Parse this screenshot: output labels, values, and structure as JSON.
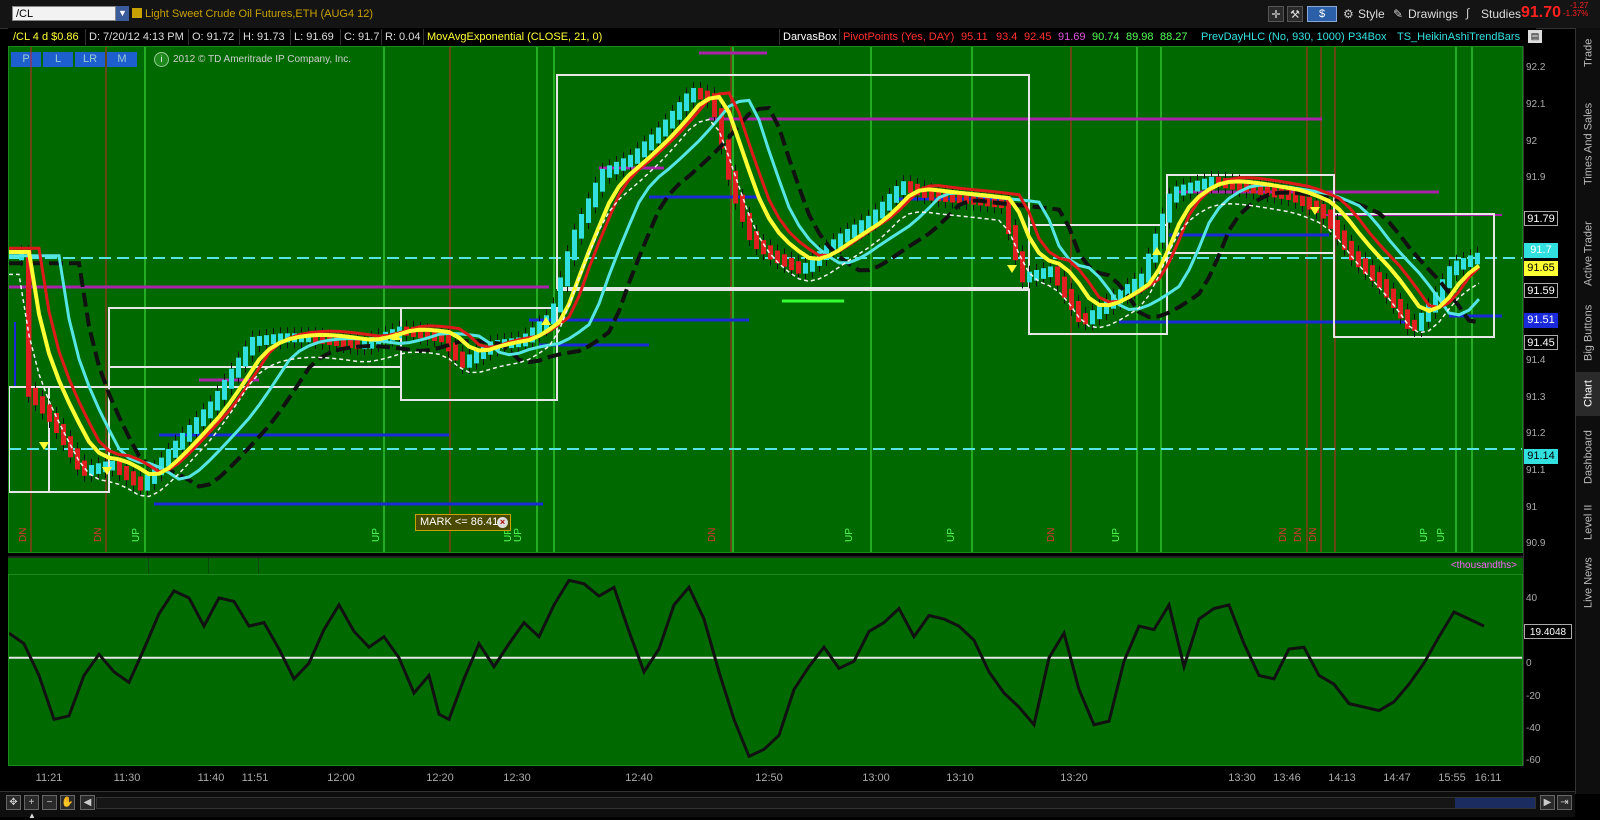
{
  "toolbar": {
    "symbol": "/CL",
    "instrument": "Light Sweet Crude Oil Futures,ETH (AUG4 12)",
    "dollar": "$",
    "style": "Style",
    "drawings": "Drawings",
    "studies": "Studies",
    "last_price": "91.70",
    "change_abs": "-1.27",
    "change_pct": "-1.37%"
  },
  "info": {
    "aggregation": "/CL 4 d $0.86",
    "date": "D: 7/20/12 4:13 PM",
    "open": "O: 91.72",
    "high": "H: 91.73",
    "low": "L: 91.69",
    "close": "C: 91.7",
    "range": "R: 0.04",
    "ema": "MovAvgExponential (CLOSE, 21, 0)",
    "darvas": "DarvasBox",
    "pivot": "PivotPoints (Yes, DAY)",
    "pv1": "95.11",
    "pv2": "93.4",
    "pv3": "92.45",
    "pv4": "91.69",
    "pv5": "90.74",
    "pv6": "89.98",
    "pv7": "88.27",
    "prevday": "PrevDayHLC (No, 930, 1000)",
    "p34": "P34Box",
    "heikin": "TS_HeikinAshiTrendBars"
  },
  "pad": {
    "p": "P",
    "l": "L",
    "lr": "LR",
    "m": "M",
    "copyright": "2012 © TD Ameritrade IP Company, Inc."
  },
  "price_axis": {
    "ticks": [
      "92.2",
      "92.1",
      "92",
      "91.9",
      "91.79",
      "91.7",
      "91.65",
      "91.59",
      "91.51",
      "91.45",
      "91.4",
      "91.3",
      "91.2",
      "91.14",
      "91.1",
      "91",
      "90.9"
    ],
    "box_9179": "91.79",
    "box_917": "91.7",
    "box_9165": "91.65",
    "box_9159": "91.59",
    "box_9151": "91.51",
    "box_9145": "91.45",
    "box_9114": "91.14"
  },
  "mark_label": "MARK <= 86.41",
  "lower": {
    "units": "<thousandths>",
    "ticks": [
      "40",
      "20",
      "0",
      "-20",
      "-40",
      "-60"
    ],
    "value": "19.4048"
  },
  "time_axis": [
    "11:21",
    "11:30",
    "11:40",
    "11:51",
    "12:00",
    "12:20",
    "12:30",
    "12:40",
    "12:50",
    "13:00",
    "13:10",
    "13:20",
    "13:30",
    "13:46",
    "14:13",
    "14:47",
    "15:55",
    "16:11"
  ],
  "right_tabs": [
    "Trade",
    "Times And Sales",
    "Active Trader",
    "Big Buttons",
    "Chart",
    "Dashboard",
    "Level II",
    "Live News"
  ],
  "signal_labels": {
    "dn": "DN",
    "up": "UP"
  },
  "colors": {
    "bg": "#006a00",
    "up_bar": "#33e0e0",
    "down_bar": "#e02020",
    "ema_yellow": "#ffff33",
    "ema_cyan": "#55e5e5",
    "ema_red": "#e01a1a",
    "pivot_magenta": "#aa22aa",
    "blue_line": "#1a2ad8"
  },
  "chart_data": {
    "type": "candlestick",
    "price_range": [
      90.88,
      92.24
    ],
    "oscillator_range": [
      -62,
      47
    ],
    "price_path": [
      [
        15,
        91.32
      ],
      [
        40,
        91.24
      ],
      [
        70,
        91.1
      ],
      [
        100,
        91.12
      ],
      [
        130,
        91.06
      ],
      [
        160,
        91.16
      ],
      [
        200,
        91.28
      ],
      [
        240,
        91.45
      ],
      [
        270,
        91.46
      ],
      [
        300,
        91.46
      ],
      [
        350,
        91.44
      ],
      [
        390,
        91.48
      ],
      [
        430,
        91.46
      ],
      [
        450,
        91.39
      ],
      [
        480,
        91.44
      ],
      [
        510,
        91.45
      ],
      [
        540,
        91.52
      ],
      [
        560,
        91.72
      ],
      [
        590,
        91.9
      ],
      [
        620,
        91.94
      ],
      [
        650,
        92.02
      ],
      [
        680,
        92.12
      ],
      [
        700,
        92.1
      ],
      [
        720,
        91.86
      ],
      [
        740,
        91.72
      ],
      [
        760,
        91.68
      ],
      [
        790,
        91.64
      ],
      [
        830,
        91.73
      ],
      [
        860,
        91.78
      ],
      [
        890,
        91.87
      ],
      [
        920,
        91.84
      ],
      [
        960,
        91.83
      ],
      [
        990,
        91.82
      ],
      [
        1010,
        91.62
      ],
      [
        1040,
        91.64
      ],
      [
        1070,
        91.5
      ],
      [
        1100,
        91.56
      ],
      [
        1130,
        91.62
      ],
      [
        1160,
        91.85
      ],
      [
        1200,
        91.88
      ],
      [
        1240,
        91.86
      ],
      [
        1280,
        91.84
      ],
      [
        1310,
        91.8
      ],
      [
        1340,
        91.68
      ],
      [
        1370,
        91.6
      ],
      [
        1400,
        91.48
      ],
      [
        1420,
        91.55
      ],
      [
        1440,
        91.65
      ],
      [
        1470,
        91.68
      ]
    ],
    "osc_path": [
      [
        0,
        14
      ],
      [
        15,
        8
      ],
      [
        30,
        -10
      ],
      [
        45,
        -35
      ],
      [
        60,
        -33
      ],
      [
        75,
        -10
      ],
      [
        90,
        2
      ],
      [
        105,
        -8
      ],
      [
        120,
        -14
      ],
      [
        135,
        5
      ],
      [
        150,
        25
      ],
      [
        165,
        38
      ],
      [
        180,
        34
      ],
      [
        195,
        18
      ],
      [
        210,
        34
      ],
      [
        225,
        32
      ],
      [
        240,
        18
      ],
      [
        255,
        20
      ],
      [
        270,
        5
      ],
      [
        285,
        -12
      ],
      [
        300,
        -3
      ],
      [
        315,
        16
      ],
      [
        330,
        30
      ],
      [
        345,
        15
      ],
      [
        360,
        6
      ],
      [
        375,
        12
      ],
      [
        390,
        0
      ],
      [
        405,
        -20
      ],
      [
        420,
        -10
      ],
      [
        430,
        -32
      ],
      [
        440,
        -35
      ],
      [
        455,
        -12
      ],
      [
        470,
        8
      ],
      [
        485,
        -5
      ],
      [
        500,
        8
      ],
      [
        515,
        20
      ],
      [
        530,
        12
      ],
      [
        545,
        30
      ],
      [
        560,
        44
      ],
      [
        575,
        42
      ],
      [
        590,
        35
      ],
      [
        605,
        40
      ],
      [
        620,
        15
      ],
      [
        635,
        -8
      ],
      [
        650,
        5
      ],
      [
        665,
        30
      ],
      [
        680,
        40
      ],
      [
        695,
        22
      ],
      [
        710,
        -8
      ],
      [
        725,
        -35
      ],
      [
        740,
        -56
      ],
      [
        755,
        -52
      ],
      [
        770,
        -44
      ],
      [
        785,
        -18
      ],
      [
        800,
        -5
      ],
      [
        815,
        6
      ],
      [
        830,
        -6
      ],
      [
        845,
        -2
      ],
      [
        860,
        15
      ],
      [
        875,
        20
      ],
      [
        890,
        28
      ],
      [
        905,
        12
      ],
      [
        920,
        24
      ],
      [
        935,
        22
      ],
      [
        950,
        18
      ],
      [
        965,
        10
      ],
      [
        980,
        -8
      ],
      [
        995,
        -20
      ],
      [
        1010,
        -28
      ],
      [
        1025,
        -38
      ],
      [
        1040,
        0
      ],
      [
        1055,
        14
      ],
      [
        1070,
        -18
      ],
      [
        1085,
        -38
      ],
      [
        1100,
        -36
      ],
      [
        1115,
        -2
      ],
      [
        1130,
        18
      ],
      [
        1145,
        16
      ],
      [
        1160,
        30
      ],
      [
        1175,
        -5
      ],
      [
        1190,
        22
      ],
      [
        1205,
        28
      ],
      [
        1220,
        30
      ],
      [
        1235,
        8
      ],
      [
        1250,
        -10
      ],
      [
        1265,
        -12
      ],
      [
        1280,
        5
      ],
      [
        1295,
        6
      ],
      [
        1310,
        -10
      ],
      [
        1325,
        -15
      ],
      [
        1340,
        -26
      ],
      [
        1355,
        -28
      ],
      [
        1370,
        -30
      ],
      [
        1385,
        -25
      ],
      [
        1400,
        -15
      ],
      [
        1415,
        -3
      ],
      [
        1430,
        12
      ],
      [
        1445,
        26
      ],
      [
        1460,
        22
      ],
      [
        1475,
        18
      ]
    ]
  }
}
